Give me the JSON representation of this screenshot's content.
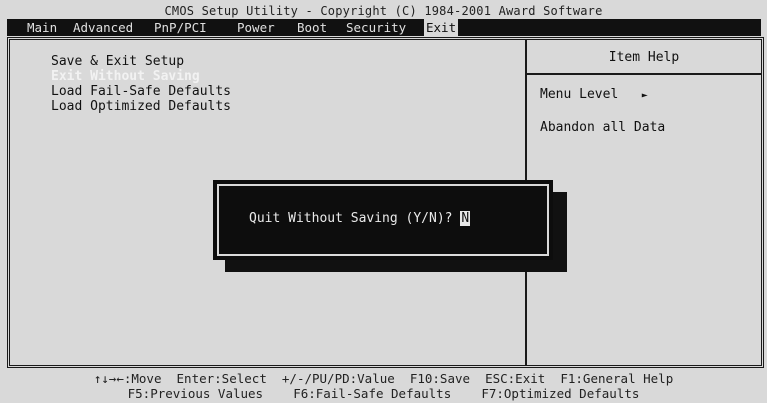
{
  "title": "CMOS Setup Utility - Copyright (C) 1984-2001 Award Software",
  "menu": {
    "tabs": [
      {
        "label": "Main"
      },
      {
        "label": "Advanced"
      },
      {
        "label": "PnP/PCI"
      },
      {
        "label": "Power"
      },
      {
        "label": "Boot"
      },
      {
        "label": "Security"
      },
      {
        "label": "Exit"
      }
    ],
    "active": "Exit"
  },
  "exit_menu": {
    "items": [
      {
        "label": "Save & Exit Setup"
      },
      {
        "label": "Exit Without Saving"
      },
      {
        "label": "Load Fail-Safe Defaults"
      },
      {
        "label": "Load Optimized Defaults"
      }
    ],
    "selected": "Exit Without Saving"
  },
  "item_help": {
    "title": "Item Help",
    "menu_level_label": "Menu Level",
    "menu_level_arrow": "►",
    "description": "Abandon all Data"
  },
  "dialog": {
    "prompt": "Quit Without Saving (Y/N)? ",
    "value": "N"
  },
  "footer": {
    "line1": "↑↓→←:Move  Enter:Select  +/-/PU/PD:Value  F10:Save  ESC:Exit  F1:General Help",
    "line2": "F5:Previous Values    F6:Fail-Safe Defaults    F7:Optimized Defaults"
  }
}
